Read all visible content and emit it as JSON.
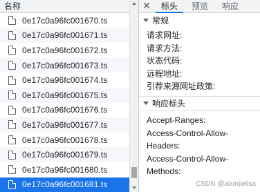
{
  "file_list": {
    "column_header": "名称",
    "rows": [
      "0e17c0a96fc001670.ts",
      "0e17c0a96fc001671.ts",
      "0e17c0a96fc001672.ts",
      "0e17c0a96fc001673.ts",
      "0e17c0a96fc001674.ts",
      "0e17c0a96fc001675.ts",
      "0e17c0a96fc001676.ts",
      "0e17c0a96fc001677.ts",
      "0e17c0a96fc001678.ts",
      "0e17c0a96fc001679.ts",
      "0e17c0a96fc001680.ts",
      "0e17c0a96fc001681.ts"
    ],
    "selected_index": 11
  },
  "detail_panel": {
    "close_label": "✕",
    "tabs": [
      "标头",
      "预览",
      "响应"
    ],
    "active_tab": "标头",
    "general": {
      "title": "常规",
      "fields": [
        "请求网址:",
        "请求方法:",
        "状态代码:",
        "远程地址:",
        "引荐来源网址政策:"
      ]
    },
    "response_headers": {
      "title": "响应标头",
      "lines": [
        "Accept-Ranges:",
        "Access-Control-Allow-",
        "Headers:",
        "Access-Control-Allow-",
        "Methods:"
      ]
    }
  },
  "watermark": "CSDN @aixinjielisa",
  "colors": {
    "selected_row": "#1a73e8",
    "tab_underline": "#1a73e8"
  }
}
